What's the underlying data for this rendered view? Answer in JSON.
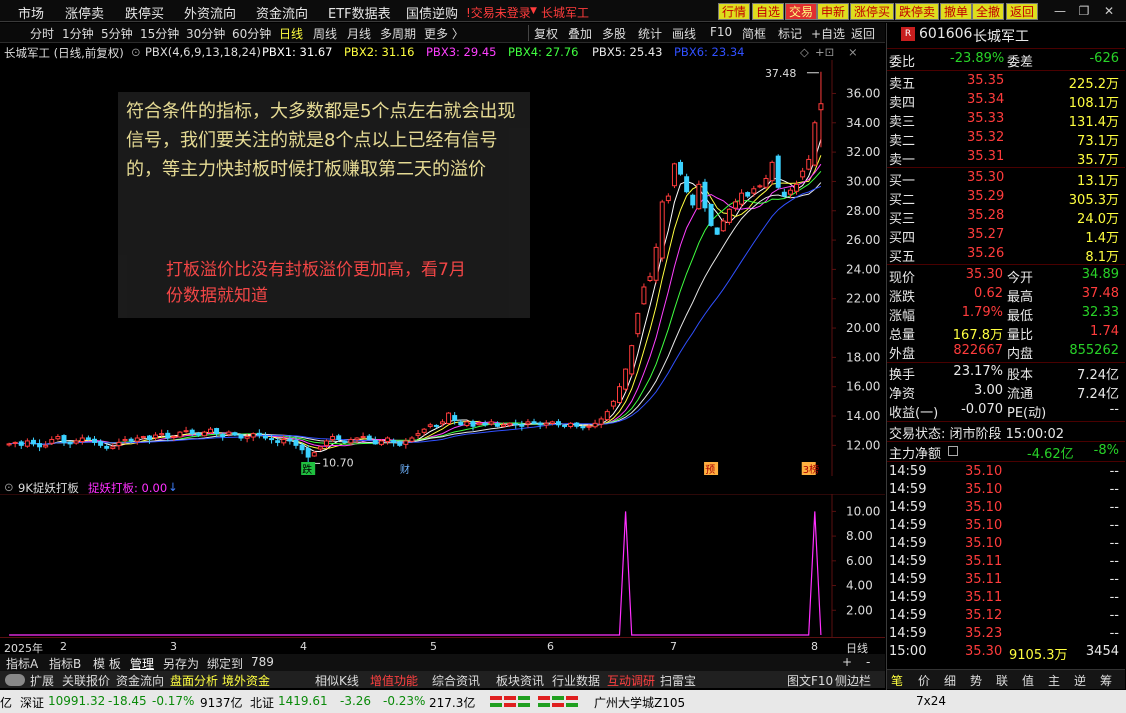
{
  "menu": {
    "items": [
      "市场",
      "涨停卖",
      "跌停买",
      "外资流向",
      "资金流向",
      "ETF数据表",
      "国债逆购"
    ],
    "warning": "!交易未登录",
    "stock_link": "长城军工",
    "buttons": [
      "行情",
      "自选",
      "交易",
      "申新",
      "涨停买",
      "跌停卖",
      "撤单",
      "全撤",
      "返回"
    ]
  },
  "periods": [
    "分时",
    "1分钟",
    "5分钟",
    "15分钟",
    "30分钟",
    "60分钟",
    "日线",
    "周线",
    "月线",
    "多周期",
    "更多 〉"
  ],
  "active_period": "日线",
  "right_tools": [
    "复权",
    "叠加",
    "多股",
    "统计",
    "画线",
    "F10",
    "简框",
    "标记",
    "+自选",
    "返回"
  ],
  "info": {
    "title": "长城军工 (日线,前复权)",
    "pbx_label": "PBX(4,6,9,13,18,24)",
    "pbx1": "PBX1: 31.67",
    "pbx2": "PBX2: 31.16",
    "pbx3": "PBX3: 29.45",
    "pbx4": "PBX4: 27.76",
    "pbx5": "PBX5: 25.43",
    "pbx6": "PBX6: 23.34"
  },
  "annotation": {
    "main_text": "符合条件的指标，大多数都是5个点左右就会出现信号，我们要关注的就是8个点以上已经有信号的，等主力快封板时候打板赚取第二天的溢价",
    "red_text": "打板溢价比没有封板溢价更加高，看7月份数据就知道"
  },
  "price_labels": {
    "high": "37.48",
    "low": "10.70"
  },
  "event_markers": [
    "跌",
    "财",
    "预",
    "3榜"
  ],
  "indicator": {
    "name": "9K捉妖打板",
    "value_label": "捉妖打板: 0.00"
  },
  "x_labels": [
    "2025年",
    "2",
    "3",
    "4",
    "5",
    "6",
    "7",
    "8"
  ],
  "x_right": "日线",
  "tabs": [
    "指标A",
    "指标B",
    "模 板",
    "管理",
    "另存为",
    "绑定到",
    "789"
  ],
  "funcbar": [
    "扩展",
    "关联报价",
    "资金流向",
    "盘面分析",
    "境外资金",
    "相似K线",
    "增值功能",
    "综合资讯",
    "板块资讯",
    "行业数据",
    "互动调研",
    "扫雷宝",
    "图文F10",
    "侧边栏 《"
  ],
  "status": {
    "left_value": "亿",
    "sz_label": "深证",
    "sz_value": "10991.32",
    "sz_change": "-18.45",
    "sz_pct": "-0.17%",
    "sz_amount": "9137亿",
    "bz_label": "北证",
    "bz_value": "1419.61",
    "bz_change": "-3.26",
    "bz_pct": "-0.23%",
    "bz_amount": "217.3亿",
    "location": "广州大学城Z105",
    "right_text": "7x24"
  },
  "quote": {
    "code": "601606",
    "name": "长城军工",
    "ratio_label": "委比",
    "ratio": "-23.89%",
    "diff_label": "委差",
    "diff": "-626",
    "asks": [
      {
        "label": "卖五",
        "price": "35.35",
        "vol": "225.2万"
      },
      {
        "label": "卖四",
        "price": "35.34",
        "vol": "108.1万"
      },
      {
        "label": "卖三",
        "price": "35.33",
        "vol": "131.4万"
      },
      {
        "label": "卖二",
        "price": "35.32",
        "vol": "73.1万"
      },
      {
        "label": "卖一",
        "price": "35.31",
        "vol": "35.7万"
      }
    ],
    "bids": [
      {
        "label": "买一",
        "price": "35.30",
        "vol": "13.1万"
      },
      {
        "label": "买二",
        "price": "35.29",
        "vol": "305.3万"
      },
      {
        "label": "买三",
        "price": "35.28",
        "vol": "24.0万"
      },
      {
        "label": "买四",
        "price": "35.27",
        "vol": "1.4万"
      },
      {
        "label": "买五",
        "price": "35.26",
        "vol": "8.1万"
      }
    ],
    "stats": [
      {
        "l1": "现价",
        "v1": "35.30",
        "c1": "up",
        "l2": "今开",
        "v2": "34.89",
        "c2": "dn"
      },
      {
        "l1": "涨跌",
        "v1": "0.62",
        "c1": "up",
        "l2": "最高",
        "v2": "37.48",
        "c2": "up"
      },
      {
        "l1": "涨幅",
        "v1": "1.79%",
        "c1": "up",
        "l2": "最低",
        "v2": "32.33",
        "c2": "dn"
      },
      {
        "l1": "总量",
        "v1": "167.8万",
        "c1": "ye",
        "l2": "量比",
        "v2": "1.74",
        "c2": "up"
      },
      {
        "l1": "外盘",
        "v1": "822667",
        "c1": "up",
        "l2": "内盘",
        "v2": "855262",
        "c2": "dn"
      }
    ],
    "stats2": [
      {
        "l1": "换手",
        "v1": "23.17%",
        "l2": "股本",
        "v2": "7.24亿"
      },
      {
        "l1": "净资",
        "v1": "3.00",
        "l2": "流通",
        "v2": "7.24亿"
      },
      {
        "l1": "收益(一)",
        "v1": "-0.070",
        "l2": "PE(动)",
        "v2": "--"
      }
    ],
    "trade_status": "交易状态: 闭市阶段 15:00:02",
    "net_label": "主力净额",
    "net_value": "-4.62亿",
    "net_pct": "-8%",
    "ticks": [
      {
        "time": "14:59",
        "price": "35.10",
        "vol": "--"
      },
      {
        "time": "14:59",
        "price": "35.10",
        "vol": "--"
      },
      {
        "time": "14:59",
        "price": "35.10",
        "vol": "--"
      },
      {
        "time": "14:59",
        "price": "35.10",
        "vol": "--"
      },
      {
        "time": "14:59",
        "price": "35.10",
        "vol": "--"
      },
      {
        "time": "14:59",
        "price": "35.11",
        "vol": "--"
      },
      {
        "time": "14:59",
        "price": "35.11",
        "vol": "--"
      },
      {
        "time": "14:59",
        "price": "35.11",
        "vol": "--"
      },
      {
        "time": "14:59",
        "price": "35.12",
        "vol": "--"
      },
      {
        "time": "14:59",
        "price": "35.23",
        "vol": "--"
      },
      {
        "time": "15:00",
        "price": "35.30",
        "vol": "9105.3万",
        "extra": "3454"
      }
    ],
    "bottom_tabs": [
      "笔",
      "价",
      "细",
      "势",
      "联",
      "值",
      "主",
      "逆",
      "筹"
    ]
  },
  "chart_data": [
    {
      "type": "candlestick",
      "title": "长城军工 (日线,前复权)",
      "y_ticks": [
        12,
        14,
        16,
        18,
        20,
        22,
        24,
        26,
        28,
        30,
        32,
        34,
        36
      ],
      "ylim": [
        11.0,
        37.6
      ],
      "x_categories": [
        "2025年",
        "2",
        "3",
        "4",
        "5",
        "6",
        "7",
        "8"
      ],
      "high_label": 37.48,
      "low_label": 10.7,
      "close": [
        12.1,
        12.2,
        12.0,
        12.3,
        12.1,
        11.9,
        12.0,
        12.4,
        12.6,
        12.2,
        12.1,
        12.3,
        12.5,
        12.4,
        12.2,
        12.0,
        11.8,
        11.9,
        12.2,
        12.4,
        12.3,
        12.5,
        12.6,
        12.4,
        12.7,
        12.8,
        12.5,
        12.6,
        12.9,
        13.0,
        12.8,
        12.7,
        12.9,
        13.1,
        12.8,
        12.6,
        12.9,
        12.7,
        12.5,
        12.6,
        12.8,
        12.7,
        12.5,
        12.4,
        12.2,
        12.4,
        12.3,
        12.0,
        11.7,
        11.2,
        11.5,
        11.9,
        12.3,
        12.6,
        12.4,
        12.2,
        12.4,
        12.5,
        12.6,
        12.4,
        12.1,
        12.3,
        12.5,
        12.2,
        12.0,
        12.3,
        12.5,
        12.8,
        13.1,
        13.4,
        13.3,
        13.6,
        14.2,
        13.7,
        13.4,
        13.6,
        13.3,
        13.5,
        13.4,
        13.6,
        13.3,
        13.4,
        13.5,
        13.4,
        13.3,
        13.6,
        13.5,
        13.4,
        13.5,
        13.6,
        13.4,
        13.3,
        13.5,
        13.3,
        13.2,
        13.3,
        13.5,
        13.8,
        14.3,
        15.0,
        16.0,
        17.2,
        18.8,
        21.0,
        22.8,
        23.5,
        25.5,
        28.6,
        29.0,
        31.2,
        30.5,
        29.3,
        28.4,
        29.8,
        28.2,
        27.0,
        26.4,
        27.3,
        28.1,
        28.6,
        29.2,
        29.0,
        29.5,
        29.7,
        30.2,
        31.3,
        29.6,
        29.0,
        29.4,
        29.8,
        30.7,
        31.5,
        34.0,
        35.3
      ],
      "series": [
        {
          "name": "PBX1",
          "value": 31.67,
          "color": "#ffffff"
        },
        {
          "name": "PBX2",
          "value": 31.16,
          "color": "#ffff40"
        },
        {
          "name": "PBX3",
          "value": 29.45,
          "color": "#ff40ff"
        },
        {
          "name": "PBX4",
          "value": 27.76,
          "color": "#40ff40"
        },
        {
          "name": "PBX5",
          "value": 25.43,
          "color": "#e8e8e8"
        },
        {
          "name": "PBX6",
          "value": 23.34,
          "color": "#3050ff"
        }
      ]
    },
    {
      "type": "line",
      "title": "9K捉妖打板",
      "series": [
        {
          "name": "捉妖打板",
          "color": "#ff30ff"
        }
      ],
      "y_ticks": [
        2,
        4,
        6,
        8,
        10
      ],
      "ylim": [
        0,
        11
      ],
      "spike_indices": [
        101,
        132
      ],
      "spike_value": 10
    }
  ]
}
